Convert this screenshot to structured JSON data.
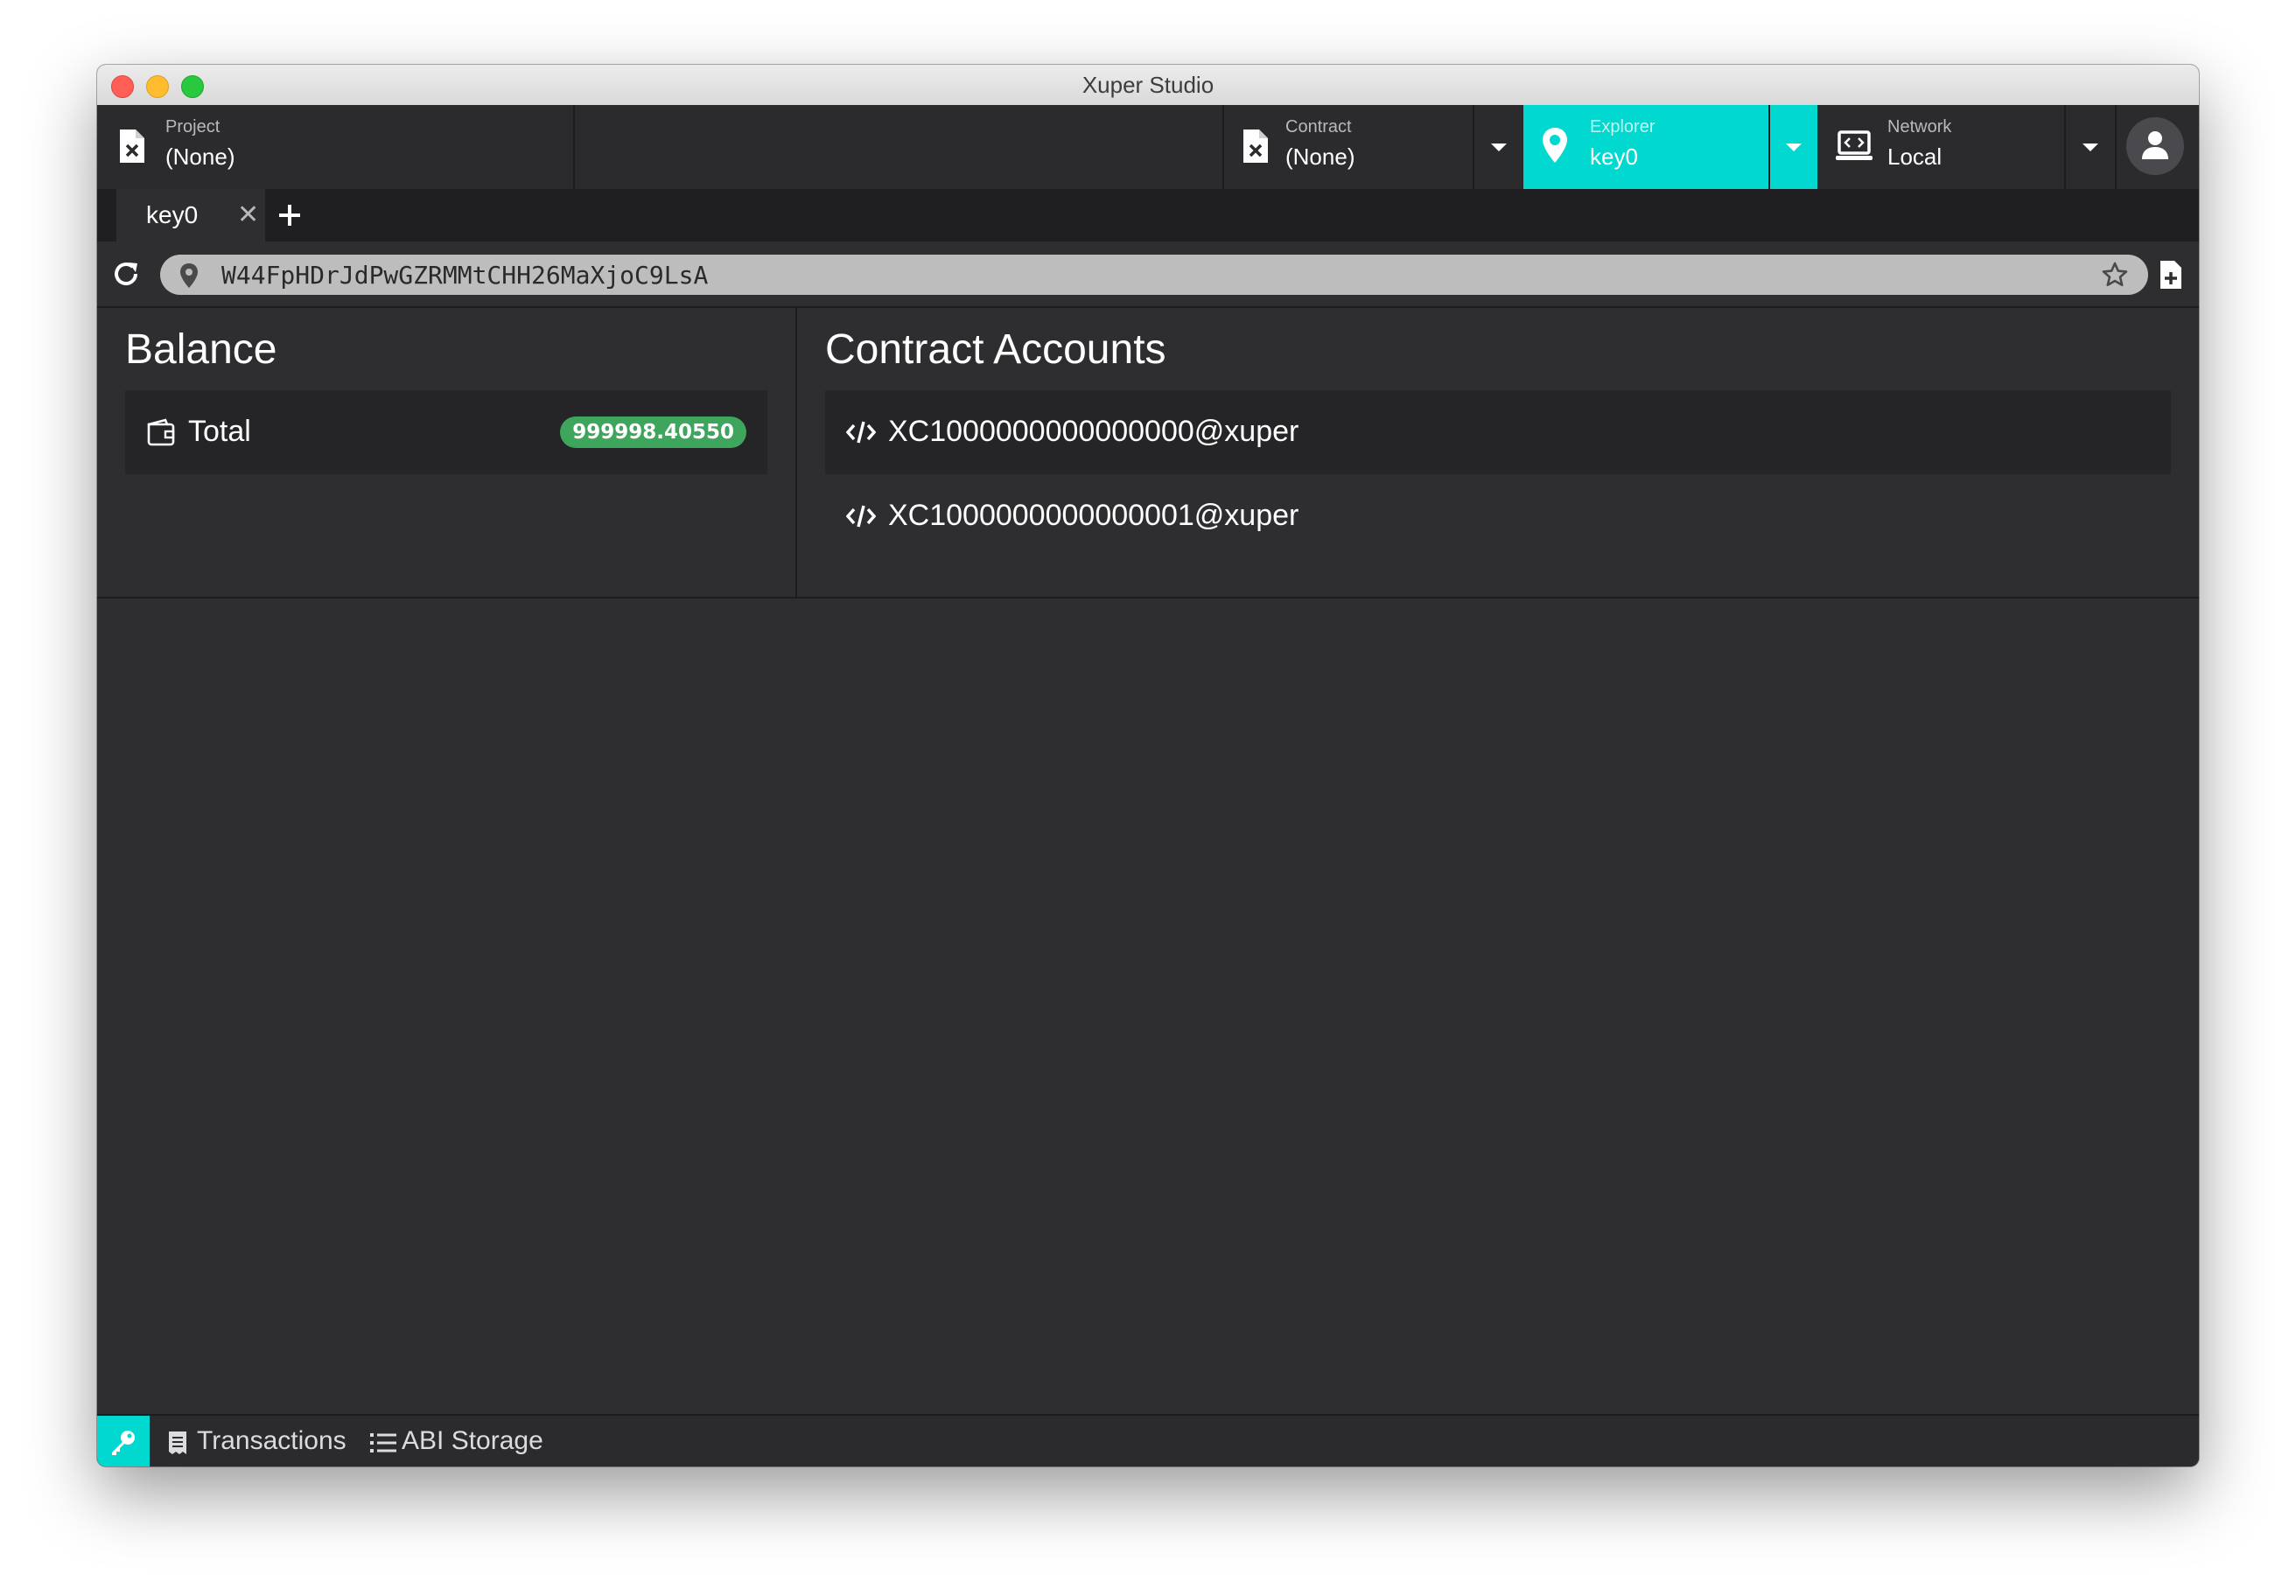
{
  "window": {
    "title": "Xuper Studio"
  },
  "header": {
    "project": {
      "label": "Project",
      "value": "(None)",
      "icon": "file-x-icon"
    },
    "contract": {
      "label": "Contract",
      "value": "(None)",
      "icon": "file-x-icon"
    },
    "explorer": {
      "label": "Explorer",
      "value": "key0",
      "icon": "map-pin-icon"
    },
    "network": {
      "label": "Network",
      "value": "Local",
      "icon": "laptop-code-icon"
    },
    "accent_color": "#00d8d0"
  },
  "tabs": [
    {
      "label": "key0",
      "close": "✕"
    }
  ],
  "address": {
    "value": "W44FpHDrJdPwGZRMMtCHH26MaXjoC9LsA"
  },
  "balance": {
    "title": "Balance",
    "rows": [
      {
        "label": "Total",
        "value": "999998.40550"
      }
    ]
  },
  "contract_accounts": {
    "title": "Contract Accounts",
    "items": [
      "XC1000000000000000@xuper",
      "XC1000000000000001@xuper"
    ]
  },
  "bottom": {
    "transactions": "Transactions",
    "abi_storage": "ABI Storage"
  }
}
